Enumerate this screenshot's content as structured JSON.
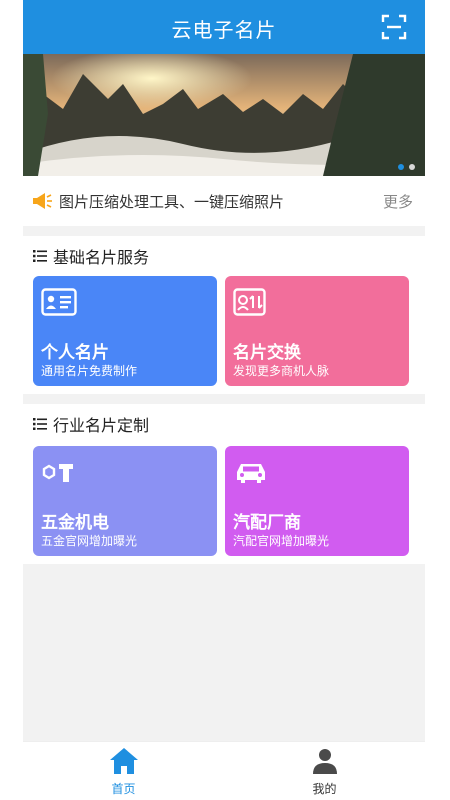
{
  "header": {
    "title": "云电子名片"
  },
  "notice": {
    "text": "图片压缩处理工具、一键压缩照片",
    "more": "更多"
  },
  "basic_section": {
    "title": "基础名片服务",
    "cards": [
      {
        "title": "个人名片",
        "subtitle": "通用名片免费制作",
        "color": "#4a86f7",
        "icon": "id-card-icon"
      },
      {
        "title": "名片交换",
        "subtitle": "发现更多商机人脉",
        "color": "#f26e9b",
        "icon": "exchange-card-icon"
      }
    ]
  },
  "industry_section": {
    "title": "行业名片定制",
    "cards": [
      {
        "title": "五金机电",
        "subtitle": "五金官网增加曝光",
        "color": "#8b91f3",
        "icon": "hardware-icon"
      },
      {
        "title": "汽配厂商",
        "subtitle": "汽配官网增加曝光",
        "color": "#d15cf0",
        "icon": "car-icon"
      }
    ]
  },
  "tabbar": {
    "items": [
      {
        "label": "首页",
        "icon": "home-icon",
        "active": true
      },
      {
        "label": "我的",
        "icon": "user-icon",
        "active": false
      }
    ]
  },
  "colors": {
    "primary": "#1f8fe0"
  }
}
